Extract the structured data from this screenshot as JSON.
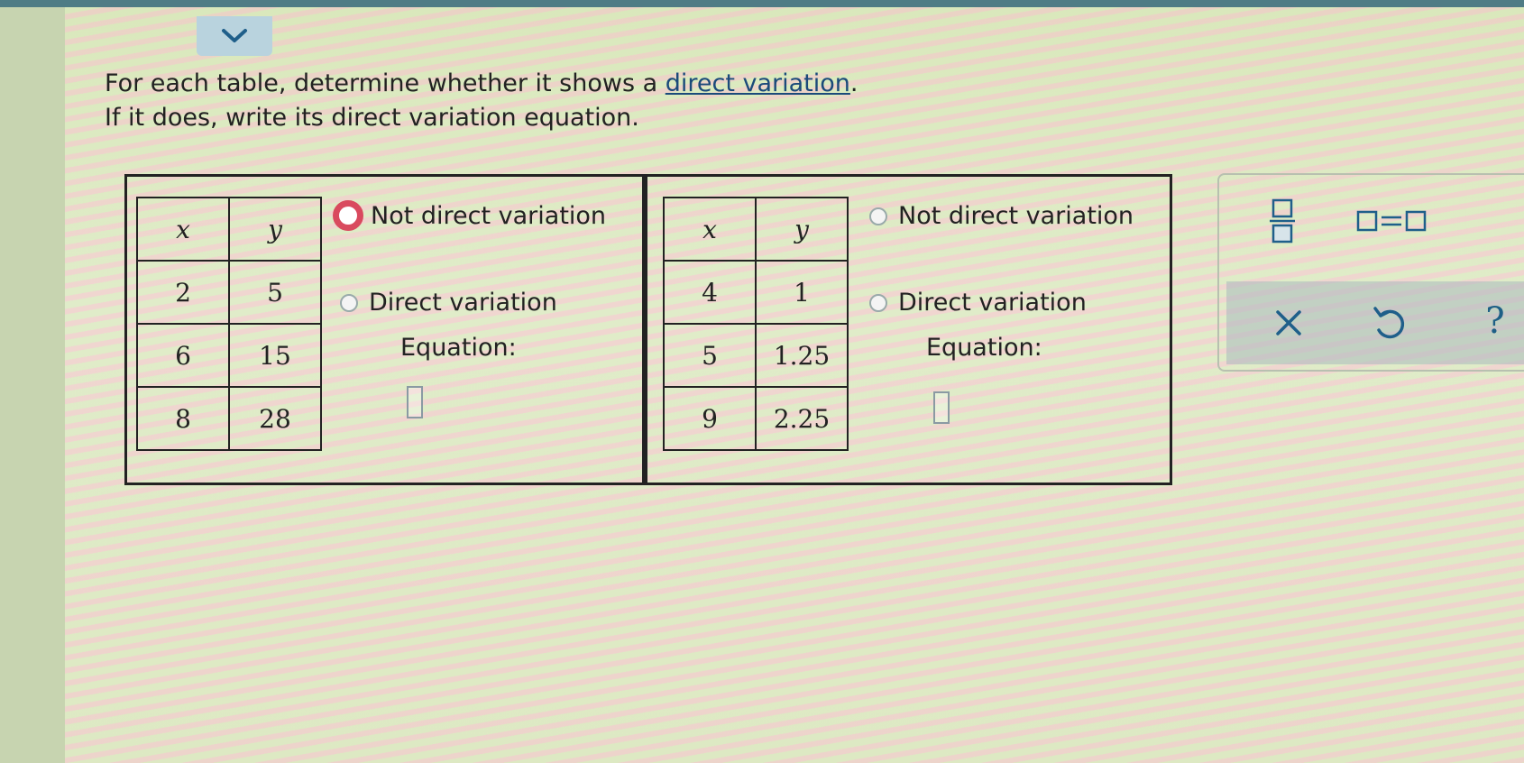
{
  "instructions": {
    "line1_prefix": "For each table, determine whether it shows a ",
    "line1_link": "direct variation",
    "line1_suffix": ".",
    "line2": "If it does, write its direct variation equation."
  },
  "problems": [
    {
      "headers": [
        "x",
        "y"
      ],
      "rows": [
        [
          "2",
          "5"
        ],
        [
          "6",
          "15"
        ],
        [
          "8",
          "28"
        ]
      ],
      "option_not_direct": "Not direct variation",
      "option_direct": "Direct variation",
      "equation_label": "Equation:",
      "selected": "not_direct"
    },
    {
      "headers": [
        "x",
        "y"
      ],
      "rows": [
        [
          "4",
          "1"
        ],
        [
          "5",
          "1.25"
        ],
        [
          "9",
          "2.25"
        ]
      ],
      "option_not_direct": "Not direct variation",
      "option_direct": "Direct variation",
      "equation_label": "Equation:",
      "selected": "none"
    }
  ],
  "toolbar": {
    "buttons": [
      "fraction-icon",
      "equals-template-icon",
      "clear-icon",
      "undo-icon",
      "help-icon"
    ],
    "help_label": "?"
  },
  "colors": {
    "selected_radio": "#d94a5e",
    "link": "#1b4a7a",
    "help": "#1e5f86"
  }
}
